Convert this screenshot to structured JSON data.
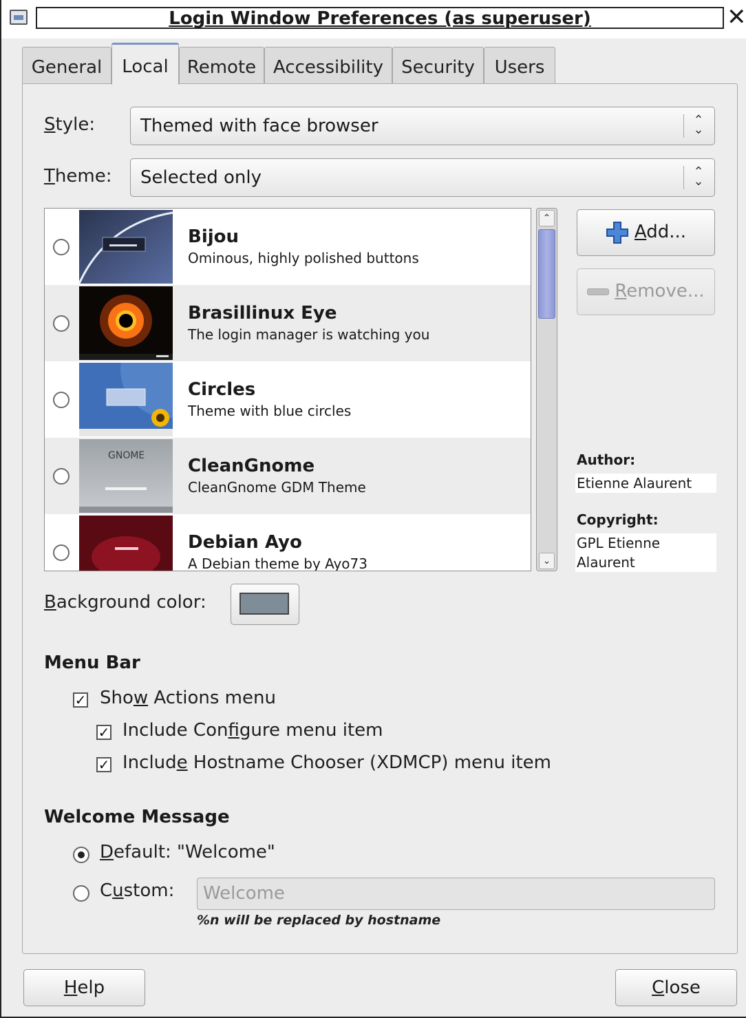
{
  "window": {
    "title": "Login Window Preferences (as superuser)",
    "close_glyph": "✕"
  },
  "tabs": [
    "General",
    "Local",
    "Remote",
    "Accessibility",
    "Security",
    "Users"
  ],
  "active_tab": "Local",
  "style": {
    "label_mnemonic": "S",
    "label_rest": "tyle:",
    "value": "Themed with face browser"
  },
  "theme": {
    "label_mnemonic": "T",
    "label_rest": "heme:",
    "value": "Selected only"
  },
  "themes": [
    {
      "name": "Bijou",
      "description": "Ominous, highly polished buttons",
      "selected": false
    },
    {
      "name": "Brasillinux Eye",
      "description": "The login manager is watching you",
      "selected": false
    },
    {
      "name": "Circles",
      "description": "Theme with blue circles",
      "selected": false
    },
    {
      "name": "CleanGnome",
      "description": "CleanGnome GDM Theme",
      "selected": false,
      "thumb_text": "GNOME"
    },
    {
      "name": "Debian Ayo",
      "description": "A Debian theme by Ayo73",
      "selected": false
    }
  ],
  "buttons": {
    "add": {
      "mnemonic": "A",
      "rest": "dd..."
    },
    "remove": {
      "mnemonic": "R",
      "rest": "emove..."
    },
    "help": {
      "mnemonic": "H",
      "rest": "elp"
    },
    "close": {
      "mnemonic": "C",
      "rest": "lose"
    }
  },
  "author": {
    "label": "Author:",
    "value": "Etienne Alaurent"
  },
  "copyright": {
    "label": "Copyright:",
    "value_line1": "GPL Etienne",
    "value_line2": "Alaurent"
  },
  "background_color": {
    "label_mnemonic": "B",
    "label_rest": "ackground color:",
    "value": "#7f8d99"
  },
  "menu_bar": {
    "heading": "Menu Bar",
    "show_actions": {
      "pre": "Sho",
      "mnemonic": "w",
      "post": " Actions menu",
      "checked": true
    },
    "include_configure": {
      "pre": "Include Con",
      "mnemonic": "f",
      "post": "igure menu item",
      "checked": true
    },
    "include_chooser": {
      "pre": "Includ",
      "mnemonic": "e",
      "post": " Hostname Chooser (XDMCP) menu item",
      "checked": true
    }
  },
  "welcome": {
    "heading": "Welcome Message",
    "default": {
      "mnemonic": "D",
      "rest": "efault: \"Welcome\"",
      "selected": true
    },
    "custom": {
      "pre": "C",
      "mnemonic": "u",
      "post": "stom:",
      "selected": false
    },
    "custom_placeholder": "Welcome",
    "hint": "%n will be replaced by hostname"
  },
  "scrollbar": {
    "up_glyph": "⌃",
    "down_glyph": "⌄"
  },
  "check_glyph": "✓"
}
